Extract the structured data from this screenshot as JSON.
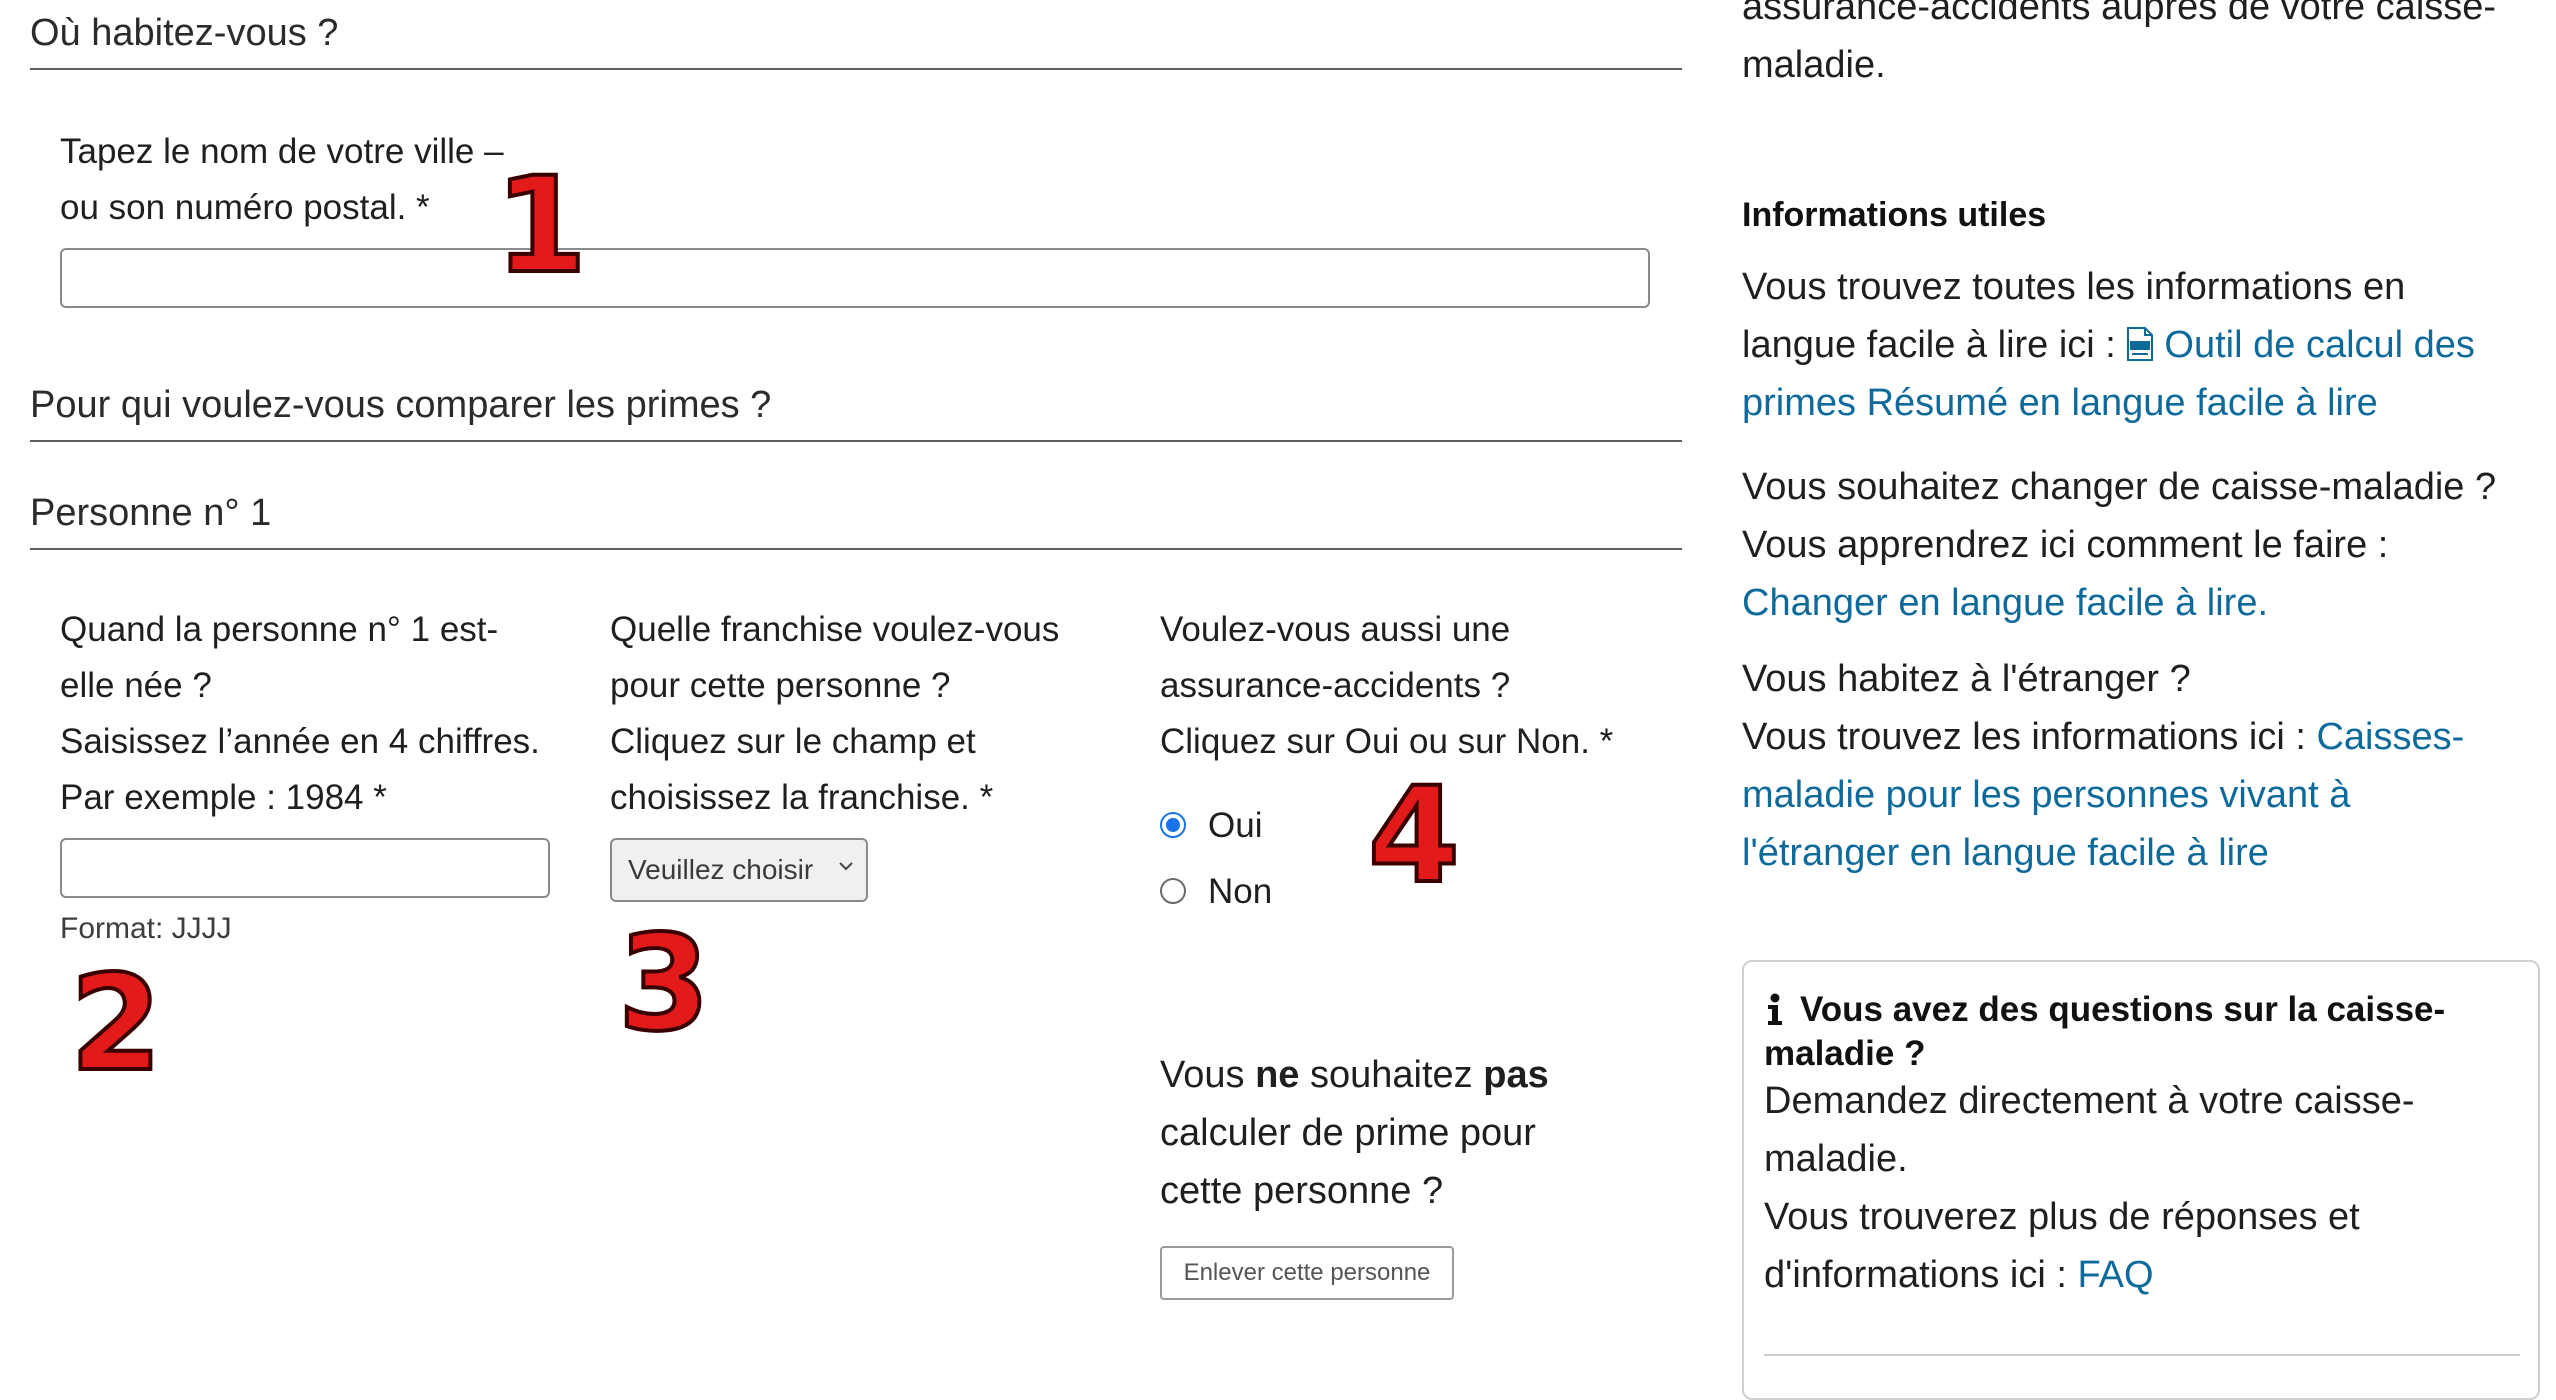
{
  "residence": {
    "title": "Où habitez-vous ?",
    "city_label_line1": "Tapez le nom de votre ville –",
    "city_label_line2": "ou son numéro postal. *",
    "city_value": ""
  },
  "compare": {
    "title": "Pour qui voulez-vous comparer les primes ?"
  },
  "person": {
    "title": "Personne n° 1",
    "birth": {
      "line1": "Quand la personne n° 1 est-",
      "line2": "elle née ?",
      "line3": "Saisissez l’année en 4 chiffres.",
      "line4": "Par exemple : 1984 *",
      "value": "",
      "format_hint": "Format: JJJJ"
    },
    "franchise": {
      "line1": "Quelle franchise voulez-vous",
      "line2": "pour cette personne ?",
      "line3": "Cliquez sur le champ et",
      "line4": "choisissez la franchise. *",
      "selected": "Veuillez choisir"
    },
    "accident": {
      "line1": "Voulez-vous aussi une",
      "line2": "assurance-accidents ?",
      "line3": "Cliquez sur Oui ou sur Non. *",
      "options": [
        "Oui",
        "Non"
      ],
      "selected": "Oui"
    },
    "remove": {
      "text_before": "Vous ",
      "bold1": "ne",
      "text_mid": " souhaitez ",
      "bold2": "pas",
      "line2": "calculer de prime pour",
      "line3": "cette personne ?",
      "button": "Enlever cette personne"
    }
  },
  "annotations": {
    "n1": "1",
    "n2": "2",
    "n3": "3",
    "n4": "4"
  },
  "sidebar": {
    "top_line1": "assurance-accidents auprès de votre caisse-",
    "top_line2": "maladie.",
    "useful_title": "Informations utiles",
    "p1_line1": "Vous trouvez toutes les informations en",
    "p1_line2_text": "langue facile à lire ici : ",
    "p1_link_line1": "Outil de calcul des",
    "p1_link_line2": "primes Résumé en langue facile à lire",
    "p2_line1": "Vous souhaitez changer de caisse-maladie ?",
    "p2_line2": "Vous apprendrez ici comment le faire :",
    "p2_link": "Changer en langue facile à lire.",
    "p3_line1": "Vous habitez à l'étranger ?",
    "p3_line2_text": "Vous trouvez les informations ici : ",
    "p3_link_part1": "Caisses-",
    "p3_link_line2": "maladie pour les personnes vivant à",
    "p3_link_line3": "l'étranger en langue facile à lire",
    "box": {
      "title_line1": "Vous avez des questions sur la caisse-",
      "title_line2": "maladie ?",
      "line1": "Demandez directement à votre caisse-",
      "line2": "maladie.",
      "line3": "Vous trouverez plus de réponses et",
      "line4_text": "d'informations ici : ",
      "line4_link": "FAQ"
    }
  },
  "colors": {
    "link": "#0f6a9c",
    "radio_accent": "#1a73e8",
    "annotation_red": "#e21a1a"
  }
}
